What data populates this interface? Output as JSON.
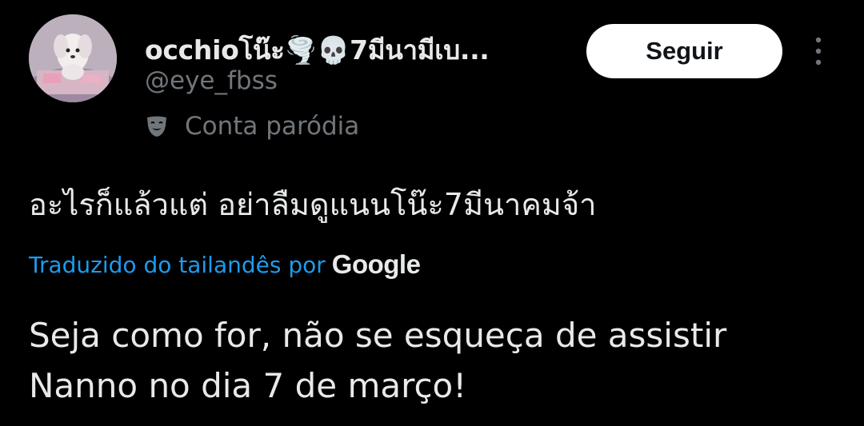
{
  "author": {
    "display_name": "occhioโน๊ะ🌪️💀7มีนามีเบ...",
    "handle": "@eye_fbss",
    "label": "Conta paródia",
    "avatar_icon": "avatar-photo",
    "label_icon": "theater-mask-icon"
  },
  "actions": {
    "follow_label": "Seguir",
    "more_icon": "more-vertical-icon"
  },
  "tweet": {
    "text": "อะไรก็แล้วแต่ อย่าลืมดูแนนโน๊ะ7มีนาคมจ้า",
    "translated_by": "Traduzido do tailandês por",
    "translator": "Google",
    "translation_line1": "Seja como for, não se esqueça de assistir",
    "translation_line2": "Nanno no dia 7 de março!"
  },
  "colors": {
    "background": "#000000",
    "primary_text": "#e7e9ea",
    "secondary_text": "#71767b",
    "link": "#1d9bf0",
    "button_bg": "#ffffff",
    "button_text": "#0f1419"
  }
}
